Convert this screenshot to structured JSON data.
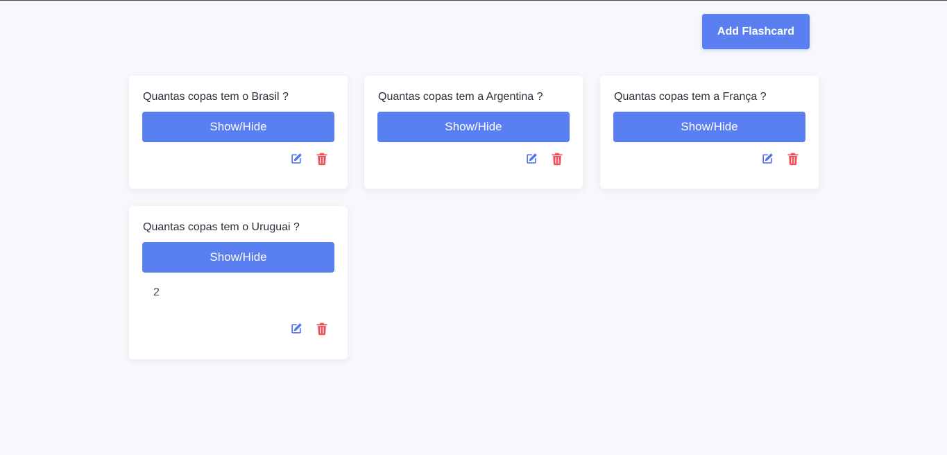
{
  "toolbar": {
    "add_label": "Add Flashcard"
  },
  "colors": {
    "accent": "#5a7ff0",
    "edit": "#4f74ee",
    "delete": "#ef4f56",
    "background": "#f7f8fc"
  },
  "cards": [
    {
      "question": "Quantas copas tem o Brasil ?",
      "toggle_label": "Show/Hide",
      "answer": ""
    },
    {
      "question": "Quantas copas tem a Argentina ?",
      "toggle_label": "Show/Hide",
      "answer": ""
    },
    {
      "question": "Quantas copas tem a França ?",
      "toggle_label": "Show/Hide",
      "answer": ""
    },
    {
      "question": "Quantas copas tem o Uruguai ?",
      "toggle_label": "Show/Hide",
      "answer": "2"
    }
  ],
  "icons": {
    "edit": "edit-icon",
    "delete": "trash-icon"
  }
}
